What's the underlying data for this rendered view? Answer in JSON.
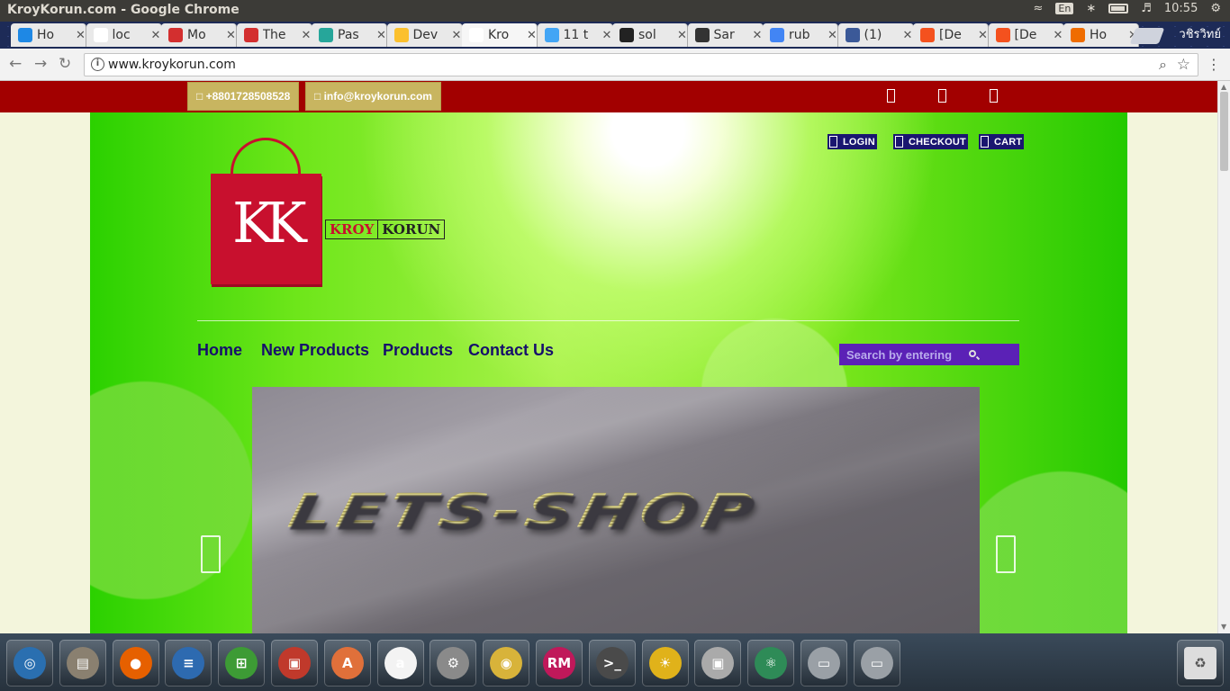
{
  "window": {
    "title": "KroyKorun.com - Google Chrome",
    "tray": {
      "language": "En",
      "clock": "10:55"
    }
  },
  "tabs": [
    {
      "label": "Ho",
      "color": "#1e88e5"
    },
    {
      "label": "loc",
      "color": "#ffffff"
    },
    {
      "label": "Mo",
      "color": "#d32f2f"
    },
    {
      "label": "The",
      "color": "#d32f2f"
    },
    {
      "label": "Pas",
      "color": "#26a69a"
    },
    {
      "label": "Dev",
      "color": "#fbc02d"
    },
    {
      "label": "Kro",
      "color": "#ffffff",
      "active": true
    },
    {
      "label": "11 t",
      "color": "#42a5f5"
    },
    {
      "label": "sol",
      "color": "#222222"
    },
    {
      "label": "Sar",
      "color": "#333333"
    },
    {
      "label": "rub",
      "color": "#4285f4"
    },
    {
      "label": "(1)",
      "color": "#3b5998"
    },
    {
      "label": "[De",
      "color": "#f4511e"
    },
    {
      "label": "[De",
      "color": "#f4511e"
    },
    {
      "label": "Ho",
      "color": "#ef6c00"
    }
  ],
  "profile_name": "วชิรวิทย์",
  "address_bar": {
    "url": "www.kroykorun.com"
  },
  "topbar": {
    "phone": "□ +8801728508528",
    "email": "□ info@kroykorun.com",
    "social_icons": [
      "facebook-icon",
      "twitter-icon",
      "google-plus-icon"
    ]
  },
  "header_links": {
    "login": "LOGIN",
    "checkout": "CHECKOUT",
    "cart": "CART"
  },
  "logo": {
    "monogram": "KK",
    "word_left": "KROY",
    "word_right": "KORUN"
  },
  "nav": {
    "home": "Home",
    "new_products": "New Products",
    "products": "Products",
    "contact_us": "Contact Us"
  },
  "search": {
    "placeholder": "Search by entering"
  },
  "hero": {
    "text": "LETS-SHOP"
  },
  "launcher": [
    {
      "name": "ubuntu-dash-icon",
      "color": "#2a6fb0",
      "glyph": "◎"
    },
    {
      "name": "files-icon",
      "color": "#8a8070",
      "glyph": "▤"
    },
    {
      "name": "firefox-icon",
      "color": "#e66000",
      "glyph": "●"
    },
    {
      "name": "writer-icon",
      "color": "#2d6ab0",
      "glyph": "≡"
    },
    {
      "name": "calc-icon",
      "color": "#3d9b35",
      "glyph": "⊞"
    },
    {
      "name": "impress-icon",
      "color": "#c0392b",
      "glyph": "▣"
    },
    {
      "name": "software-center-icon",
      "color": "#e0703a",
      "glyph": "A"
    },
    {
      "name": "amazon-icon",
      "color": "#f3f3f3",
      "glyph": "a"
    },
    {
      "name": "system-settings-icon",
      "color": "#8a8a8a",
      "glyph": "⚙"
    },
    {
      "name": "chrome-icon",
      "color": "#d8b33a",
      "glyph": "◉"
    },
    {
      "name": "rubymine-icon",
      "color": "#c0185a",
      "glyph": "RM"
    },
    {
      "name": "terminal-icon",
      "color": "#4a4a4a",
      "glyph": ">_"
    },
    {
      "name": "indicator-icon",
      "color": "#e0b21a",
      "glyph": "☀"
    },
    {
      "name": "camera-icon",
      "color": "#aaaaaa",
      "glyph": "▣"
    },
    {
      "name": "atom-icon",
      "color": "#2e8b57",
      "glyph": "⚛"
    },
    {
      "name": "drive-icon",
      "color": "#9aa0a6",
      "glyph": "▭"
    },
    {
      "name": "drive-icon-2",
      "color": "#9aa0a6",
      "glyph": "▭"
    }
  ]
}
